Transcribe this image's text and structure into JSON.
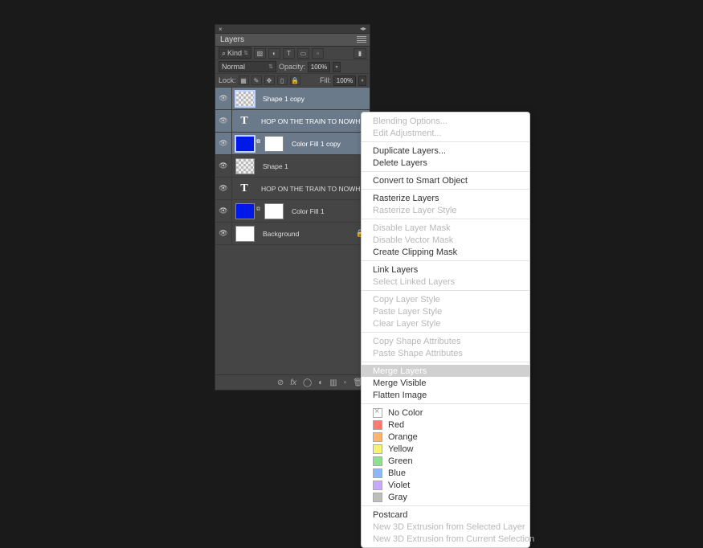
{
  "panel": {
    "title": "Layers",
    "filter_label": "Kind",
    "blend_mode": "Normal",
    "opacity_label": "Opacity:",
    "opacity_value": "100%",
    "lock_label": "Lock:",
    "fill_label": "Fill:",
    "fill_value": "100%"
  },
  "layers": [
    {
      "name": "Shape 1 copy",
      "selected": true,
      "thumbs": [
        "checker"
      ],
      "visible": true
    },
    {
      "name": "HOP ON THE TRAIN TO NOWHERE BAB...",
      "selected": true,
      "thumbs": [
        "type"
      ],
      "visible": true
    },
    {
      "name": "Color Fill 1 copy",
      "selected": true,
      "thumbs": [
        "blue",
        "mask"
      ],
      "visible": true
    },
    {
      "name": "Shape 1",
      "selected": false,
      "thumbs": [
        "checker"
      ],
      "visible": true
    },
    {
      "name": "HOP ON THE TRAIN TO NOWHERE BABY",
      "selected": false,
      "thumbs": [
        "type"
      ],
      "visible": true
    },
    {
      "name": "Color Fill 1",
      "selected": false,
      "thumbs": [
        "blue",
        "mask"
      ],
      "visible": true
    },
    {
      "name": "Background",
      "selected": false,
      "thumbs": [
        "white"
      ],
      "visible": true,
      "locked": true
    }
  ],
  "menu": {
    "groups": [
      [
        {
          "label": "Blending Options...",
          "enabled": false
        },
        {
          "label": "Edit Adjustment...",
          "enabled": false
        }
      ],
      [
        {
          "label": "Duplicate Layers...",
          "enabled": true
        },
        {
          "label": "Delete Layers",
          "enabled": true
        }
      ],
      [
        {
          "label": "Convert to Smart Object",
          "enabled": true
        }
      ],
      [
        {
          "label": "Rasterize Layers",
          "enabled": true
        },
        {
          "label": "Rasterize Layer Style",
          "enabled": false
        }
      ],
      [
        {
          "label": "Disable Layer Mask",
          "enabled": false
        },
        {
          "label": "Disable Vector Mask",
          "enabled": false
        },
        {
          "label": "Create Clipping Mask",
          "enabled": true
        }
      ],
      [
        {
          "label": "Link Layers",
          "enabled": true
        },
        {
          "label": "Select Linked Layers",
          "enabled": false
        }
      ],
      [
        {
          "label": "Copy Layer Style",
          "enabled": false
        },
        {
          "label": "Paste Layer Style",
          "enabled": false
        },
        {
          "label": "Clear Layer Style",
          "enabled": false
        }
      ],
      [
        {
          "label": "Copy Shape Attributes",
          "enabled": false
        },
        {
          "label": "Paste Shape Attributes",
          "enabled": false
        }
      ],
      [
        {
          "label": "Merge Layers",
          "enabled": true,
          "highlight": true
        },
        {
          "label": "Merge Visible",
          "enabled": true
        },
        {
          "label": "Flatten Image",
          "enabled": true
        }
      ]
    ],
    "colors": [
      {
        "label": "No Color",
        "swatch": "nocolor"
      },
      {
        "label": "Red",
        "swatch": "#ff7a6e"
      },
      {
        "label": "Orange",
        "swatch": "#ffb56e"
      },
      {
        "label": "Yellow",
        "swatch": "#f6f36e"
      },
      {
        "label": "Green",
        "swatch": "#8de08d"
      },
      {
        "label": "Blue",
        "swatch": "#8db6ff"
      },
      {
        "label": "Violet",
        "swatch": "#c9a8ff"
      },
      {
        "label": "Gray",
        "swatch": "#bdbdbd"
      }
    ],
    "footer": [
      {
        "label": "Postcard",
        "enabled": true
      },
      {
        "label": "New 3D Extrusion from Selected Layer",
        "enabled": false
      },
      {
        "label": "New 3D Extrusion from Current Selection",
        "enabled": false
      }
    ]
  }
}
